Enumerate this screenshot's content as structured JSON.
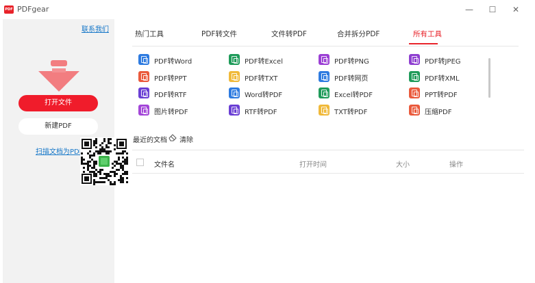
{
  "window": {
    "logo_text": "PDF",
    "title": "PDFgear",
    "minimize_glyph": "—",
    "maximize_glyph": "☐",
    "close_glyph": "✕"
  },
  "sidebar": {
    "contact_link": "联系我们",
    "open_file_button": "打开文件",
    "new_pdf_button": "新建PDF",
    "scan_link": "扫描文档为PDF",
    "accent_color": "#f01c2b",
    "arrow_color": "#f27d80"
  },
  "tabs": [
    {
      "label": "热门工具",
      "active": false
    },
    {
      "label": "PDF转文件",
      "active": false
    },
    {
      "label": "文件转PDF",
      "active": false
    },
    {
      "label": "合并拆分PDF",
      "active": false
    },
    {
      "label": "所有工具",
      "active": true
    }
  ],
  "tools": [
    {
      "label": "PDF转Word",
      "icon": "pdf-to-word-icon",
      "color": "#2e7be0"
    },
    {
      "label": "PDF转Excel",
      "icon": "pdf-to-excel-icon",
      "color": "#1f9b5a"
    },
    {
      "label": "PDF转PNG",
      "icon": "pdf-to-png-icon",
      "color": "#9b3fd4"
    },
    {
      "label": "PDF转JPEG",
      "icon": "pdf-to-jpeg-icon",
      "color": "#8e3fd0"
    },
    {
      "label": "PDF转PPT",
      "icon": "pdf-to-ppt-icon",
      "color": "#ea5a3c"
    },
    {
      "label": "PDF转TXT",
      "icon": "pdf-to-txt-icon",
      "color": "#f0b93a"
    },
    {
      "label": "PDF转网页",
      "icon": "pdf-to-html-icon",
      "color": "#2e7be0"
    },
    {
      "label": "PDF转XML",
      "icon": "pdf-to-xml-icon",
      "color": "#1f9b5a"
    },
    {
      "label": "PDF转RTF",
      "icon": "pdf-to-rtf-icon",
      "color": "#6a3fd4"
    },
    {
      "label": "Word转PDF",
      "icon": "word-to-pdf-icon",
      "color": "#2e7be0"
    },
    {
      "label": "Excel转PDF",
      "icon": "excel-to-pdf-icon",
      "color": "#1f9b5a"
    },
    {
      "label": "PPT转PDF",
      "icon": "ppt-to-pdf-icon",
      "color": "#ea5a3c"
    },
    {
      "label": "图片转PDF",
      "icon": "image-to-pdf-icon",
      "color": "#a346d8"
    },
    {
      "label": "RTF转PDF",
      "icon": "rtf-to-pdf-icon",
      "color": "#6a3fd4"
    },
    {
      "label": "TXT转PDF",
      "icon": "txt-to-pdf-icon",
      "color": "#f0b93a"
    },
    {
      "label": "压缩PDF",
      "icon": "compress-pdf-icon",
      "color": "#ea5a3c"
    }
  ],
  "recent": {
    "title": "最近的文档",
    "clear_label": "清除",
    "columns": {
      "name": "文件名",
      "time": "打开时间",
      "size": "大小",
      "op": "操作"
    }
  }
}
